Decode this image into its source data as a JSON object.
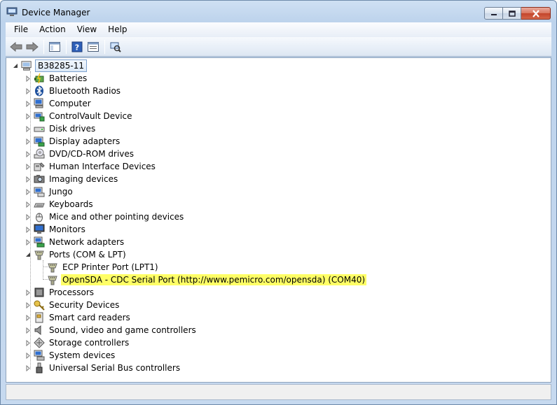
{
  "window": {
    "title": "Device Manager",
    "caption_min": "–",
    "caption_max": "□",
    "caption_close": "✕"
  },
  "menu": {
    "items": [
      "File",
      "Action",
      "View",
      "Help"
    ]
  },
  "toolbar": {
    "icons": [
      "back-arrow-icon",
      "forward-arrow-icon",
      "show-hide-console-tree-icon",
      "help-icon",
      "properties-icon",
      "scan-hardware-icon"
    ]
  },
  "tree": {
    "root": {
      "label": "B38285-11",
      "expanded": true
    },
    "categories": [
      {
        "label": "Batteries",
        "icon": "battery-icon"
      },
      {
        "label": "Bluetooth Radios",
        "icon": "bluetooth-icon"
      },
      {
        "label": "Computer",
        "icon": "computer-icon"
      },
      {
        "label": "ControlVault Device",
        "icon": "controlvault-icon"
      },
      {
        "label": "Disk drives",
        "icon": "disk-drive-icon"
      },
      {
        "label": "Display adapters",
        "icon": "display-adapter-icon"
      },
      {
        "label": "DVD/CD-ROM drives",
        "icon": "dvd-icon"
      },
      {
        "label": "Human Interface Devices",
        "icon": "hid-icon"
      },
      {
        "label": "Imaging devices",
        "icon": "camera-icon"
      },
      {
        "label": "Jungo",
        "icon": "jungo-icon"
      },
      {
        "label": "Keyboards",
        "icon": "keyboard-icon"
      },
      {
        "label": "Mice and other pointing devices",
        "icon": "mouse-icon"
      },
      {
        "label": "Monitors",
        "icon": "monitor-icon"
      },
      {
        "label": "Network adapters",
        "icon": "network-adapter-icon"
      },
      {
        "label": "Ports (COM & LPT)",
        "icon": "port-icon",
        "expanded": true,
        "children": [
          {
            "label": "ECP Printer Port (LPT1)",
            "icon": "port-icon"
          },
          {
            "label": "OpenSDA - CDC Serial Port (http://www.pemicro.com/opensda) (COM40)",
            "icon": "port-icon",
            "highlighted": true
          }
        ]
      },
      {
        "label": "Processors",
        "icon": "processor-icon"
      },
      {
        "label": "Security Devices",
        "icon": "security-device-icon"
      },
      {
        "label": "Smart card readers",
        "icon": "smart-card-icon"
      },
      {
        "label": "Sound, video and game controllers",
        "icon": "speaker-icon"
      },
      {
        "label": "Storage controllers",
        "icon": "storage-controller-icon"
      },
      {
        "label": "System devices",
        "icon": "system-device-icon"
      },
      {
        "label": "Universal Serial Bus controllers",
        "icon": "usb-icon"
      }
    ]
  },
  "colors": {
    "highlight": "#ffff66",
    "title_gradient": "#cfe0f3",
    "tree_line": "#a0a0a0"
  }
}
